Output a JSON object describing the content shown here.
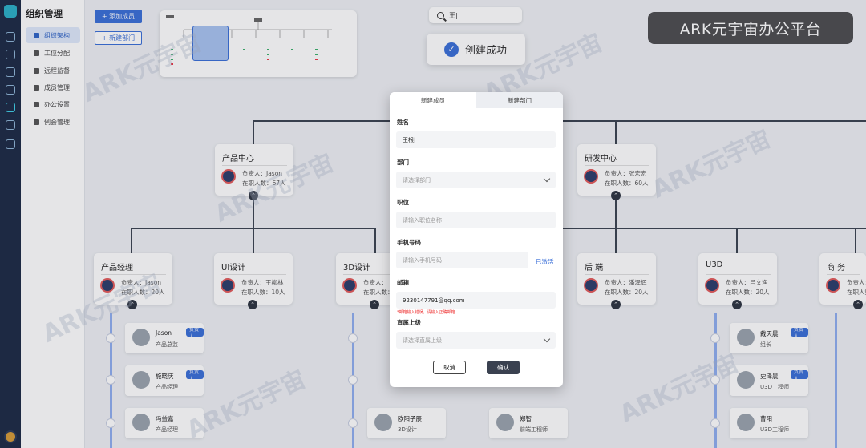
{
  "sidebar": {
    "title": "组织管理",
    "items": [
      {
        "label": "组织架构",
        "active": true
      },
      {
        "label": "工位分配"
      },
      {
        "label": "远程监督"
      },
      {
        "label": "成员管理"
      },
      {
        "label": "办公设置"
      },
      {
        "label": "例会管理"
      }
    ]
  },
  "toolbar": {
    "add_member": "+ 添加成员",
    "new_dept": "+ 新建部门"
  },
  "search": {
    "value": "王|"
  },
  "toast": {
    "check": "✓",
    "message": "创建成功"
  },
  "brand": {
    "text": "ARK元宇宙办公平台"
  },
  "watermark": "ARK元宇宙",
  "toggle_glyph": "⌃",
  "departments": [
    {
      "name": "产品中心",
      "lead": "负责人：Jason",
      "count": "在职人数：67人"
    },
    {
      "name": "研发中心",
      "lead": "负责人：张宏宏",
      "count": "在职人数：60人"
    },
    {
      "name": "产品经理",
      "lead": "负责人：Jason",
      "count": "在职人数：20人"
    },
    {
      "name": "UI设计",
      "lead": "负责人：王柳林",
      "count": "在职人数：10人"
    },
    {
      "name": "3D设计",
      "lead": "负责人：",
      "count": "在职人数："
    },
    {
      "name": "后  端",
      "lead": "负责人：潘泽辉",
      "count": "在职人数：20人"
    },
    {
      "name": "U3D",
      "lead": "负责人：吕文渔",
      "count": "在职人数：20人"
    },
    {
      "name": "商  务",
      "lead": "负责人：",
      "count": "在职人数："
    }
  ],
  "members": [
    {
      "name": "Jason",
      "role": "产品总监",
      "tag": "负责人"
    },
    {
      "name": "施晓庆",
      "role": "产品经理",
      "tag": "负责人"
    },
    {
      "name": "冯益嘉",
      "role": "产品经理",
      "tag": ""
    },
    {
      "name": "欧阳子辰",
      "role": "3D设计",
      "tag": ""
    },
    {
      "name": "郑智",
      "role": "前端工程师",
      "tag": ""
    },
    {
      "name": "戴天晨",
      "role": "组长",
      "tag": "负责人"
    },
    {
      "name": "史泽晨",
      "role": "U3D工程师",
      "tag": "负责人"
    },
    {
      "name": "曹阳",
      "role": "U3D工程师",
      "tag": ""
    }
  ],
  "modal": {
    "tab_active": "新建成员",
    "tab_inactive": "新建部门",
    "name_label": "姓名",
    "name_value": "王根|",
    "dept_label": "部门",
    "dept_placeholder": "请选择部门",
    "position_label": "职位",
    "position_placeholder": "请输入职位名称",
    "phone_label": "手机号码",
    "phone_placeholder": "请输入手机号码",
    "phone_status": "已激活",
    "email_label": "邮箱",
    "email_value": "923014779​1@qq.com",
    "email_error": "*邮箱输入错误，请输入正确邮箱",
    "manager_label": "直属上级",
    "manager_placeholder": "请选择直属上级",
    "cancel": "取消",
    "confirm": "确认"
  }
}
